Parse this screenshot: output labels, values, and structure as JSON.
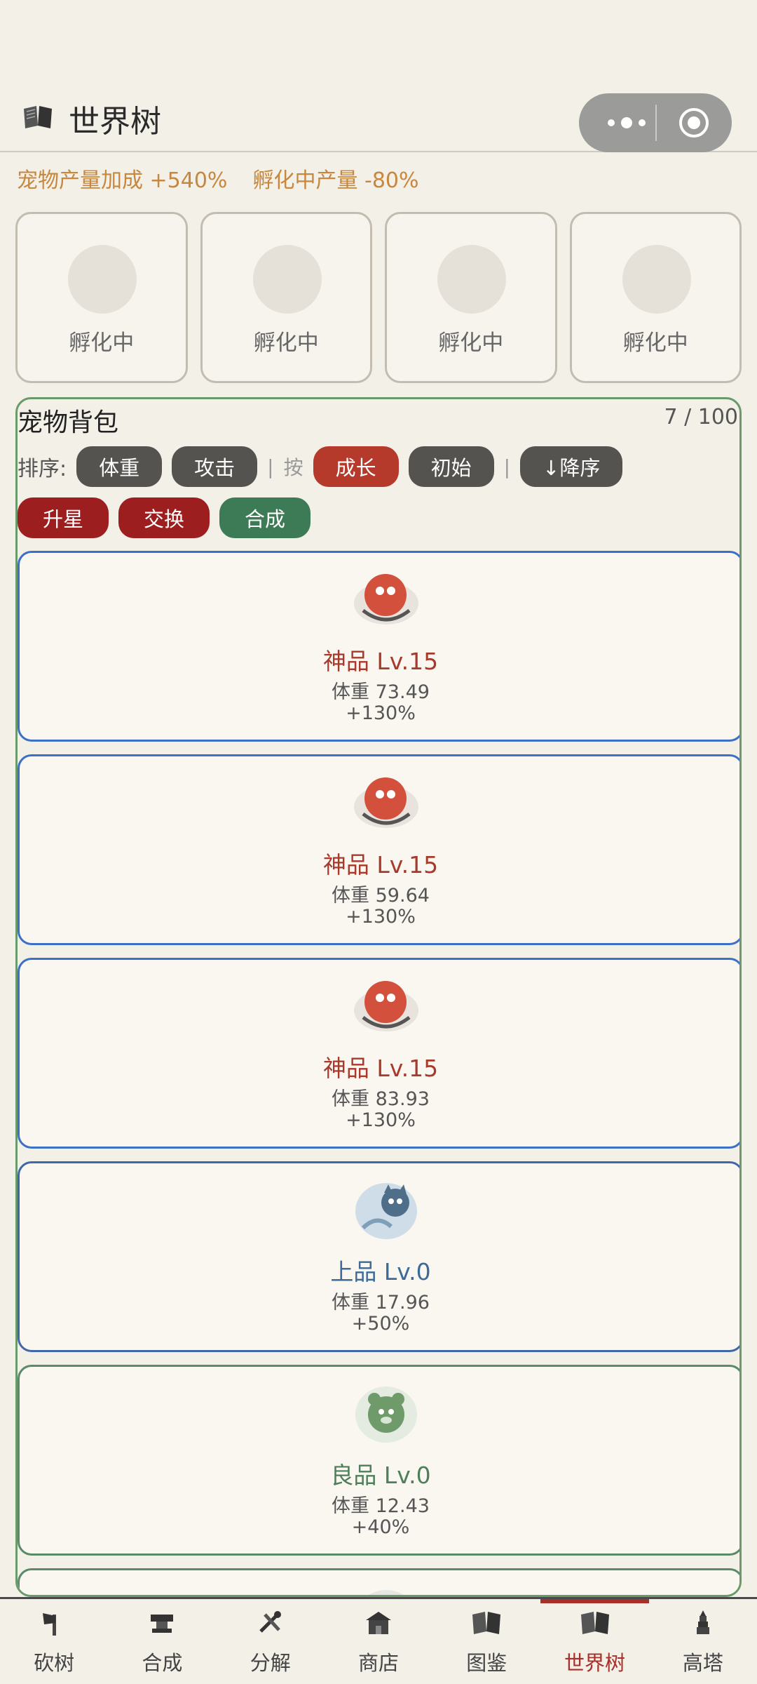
{
  "header": {
    "title": "世界树"
  },
  "bonus": {
    "pet_output": "宠物产量加成 +540%",
    "incubating_output": "孵化中产量 -80%"
  },
  "slots": [
    {
      "label": "孵化中"
    },
    {
      "label": "孵化中"
    },
    {
      "label": "孵化中"
    },
    {
      "label": "孵化中"
    }
  ],
  "bag": {
    "title": "宠物背包",
    "count": "7 / 100",
    "sort_label": "排序:",
    "sort_by_label": "按",
    "divider": "|",
    "sort_buttons": {
      "weight": "体重",
      "attack": "攻击",
      "growth": "成长",
      "initial": "初始",
      "order": "↓降序"
    },
    "actions": {
      "star_up": "升星",
      "exchange": "交换",
      "merge": "合成"
    }
  },
  "pets": [
    {
      "grade": "神品 Lv.15",
      "weight": "体重 73.49",
      "bonus": "+130%",
      "type": "divine"
    },
    {
      "grade": "神品 Lv.15",
      "weight": "体重 59.64",
      "bonus": "+130%",
      "type": "divine"
    },
    {
      "grade": "神品 Lv.15",
      "weight": "体重 83.93",
      "bonus": "+130%",
      "type": "divine"
    },
    {
      "grade": "上品 Lv.0",
      "weight": "体重 17.96",
      "bonus": "+50%",
      "type": "superior"
    },
    {
      "grade": "良品 Lv.0",
      "weight": "体重 12.43",
      "bonus": "+40%",
      "type": "good"
    }
  ],
  "nav": [
    {
      "label": "砍树",
      "icon": "axe-icon"
    },
    {
      "label": "合成",
      "icon": "anvil-icon"
    },
    {
      "label": "分解",
      "icon": "tools-icon"
    },
    {
      "label": "商店",
      "icon": "shop-icon"
    },
    {
      "label": "图鉴",
      "icon": "book-icon"
    },
    {
      "label": "世界树",
      "icon": "book-icon",
      "active": true
    },
    {
      "label": "高塔",
      "icon": "tower-icon"
    }
  ],
  "colors": {
    "accent": "#a8302a",
    "bonus_text": "#c8873e",
    "card_border": "#3c6fc6"
  }
}
